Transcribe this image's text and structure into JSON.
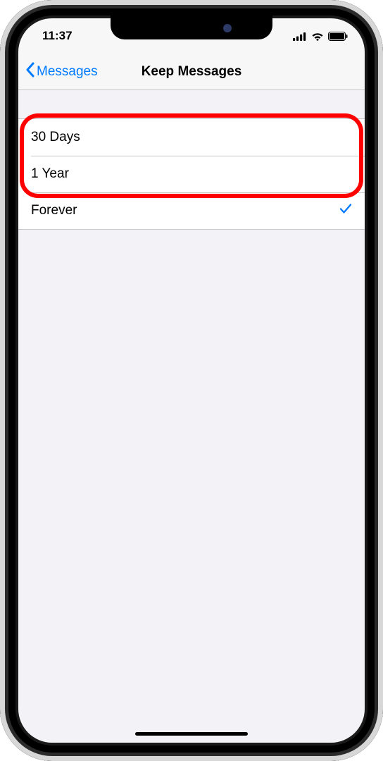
{
  "status": {
    "time": "11:37"
  },
  "nav": {
    "back": "Messages",
    "title": "Keep Messages"
  },
  "options": {
    "o0": "30 Days",
    "o1": "1 Year",
    "o2": "Forever"
  }
}
